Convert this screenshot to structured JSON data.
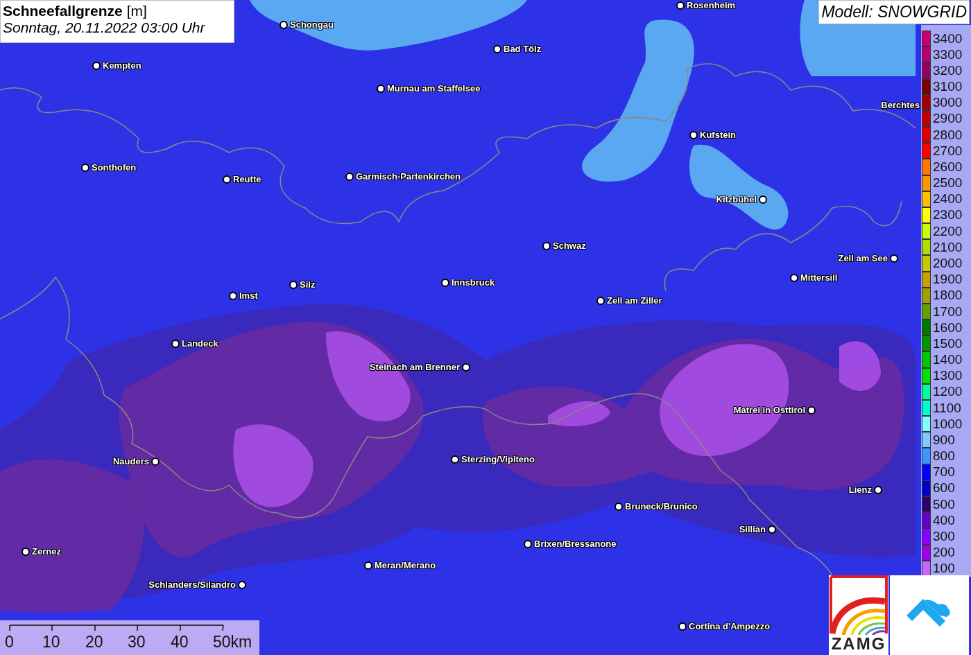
{
  "title": {
    "name": "Schneefallgrenze",
    "unit": "[m]",
    "date": "Sonntag, 20.11.2022 03:00 Uhr"
  },
  "model": "Modell: SNOWGRID",
  "cities": [
    {
      "name": "Rosenheim"
    },
    {
      "name": "Schongau"
    },
    {
      "name": "Kempten"
    },
    {
      "name": "Bad Tölz"
    },
    {
      "name": "Murnau am Staffelsee"
    },
    {
      "name": "Berchtes"
    },
    {
      "name": "Kufstein"
    },
    {
      "name": "Sonthofen"
    },
    {
      "name": "Reutte"
    },
    {
      "name": "Garmisch-Partenkirchen"
    },
    {
      "name": "Kitzbühel"
    },
    {
      "name": "Schwaz"
    },
    {
      "name": "Zell am See"
    },
    {
      "name": "Mittersill"
    },
    {
      "name": "Silz"
    },
    {
      "name": "Innsbruck"
    },
    {
      "name": "Imst"
    },
    {
      "name": "Zell am Ziller"
    },
    {
      "name": "Landeck"
    },
    {
      "name": "Steinach am Brenner"
    },
    {
      "name": "Matrei in Osttirol"
    },
    {
      "name": "Nauders"
    },
    {
      "name": "Sterzing/Vipiteno"
    },
    {
      "name": "Lienz"
    },
    {
      "name": "Bruneck/Brunico"
    },
    {
      "name": "Sillian"
    },
    {
      "name": "Zernez"
    },
    {
      "name": "Brixen/Bressanone"
    },
    {
      "name": "Meran/Merano"
    },
    {
      "name": "Schlanders/Silandro"
    },
    {
      "name": "Cortina d'Ampezzo"
    }
  ],
  "legend": [
    {
      "label": "3400",
      "color": "#c8006e"
    },
    {
      "label": "3300",
      "color": "#b40070"
    },
    {
      "label": "3200",
      "color": "#96005f"
    },
    {
      "label": "3100",
      "color": "#780000"
    },
    {
      "label": "3000",
      "color": "#a00000"
    },
    {
      "label": "2900",
      "color": "#c00000"
    },
    {
      "label": "2800",
      "color": "#e00000"
    },
    {
      "label": "2700",
      "color": "#ff0000"
    },
    {
      "label": "2600",
      "color": "#ff7800"
    },
    {
      "label": "2500",
      "color": "#ff9600"
    },
    {
      "label": "2400",
      "color": "#ffbe00"
    },
    {
      "label": "2300",
      "color": "#ffff00"
    },
    {
      "label": "2200",
      "color": "#c8ff00"
    },
    {
      "label": "2100",
      "color": "#b4dc00"
    },
    {
      "label": "2000",
      "color": "#c8c800"
    },
    {
      "label": "1900",
      "color": "#c8a000"
    },
    {
      "label": "1800",
      "color": "#a0a000"
    },
    {
      "label": "1700",
      "color": "#64a000"
    },
    {
      "label": "1600",
      "color": "#007800"
    },
    {
      "label": "1500",
      "color": "#009600"
    },
    {
      "label": "1400",
      "color": "#00c800"
    },
    {
      "label": "1300",
      "color": "#00e600"
    },
    {
      "label": "1200",
      "color": "#00ff96"
    },
    {
      "label": "1100",
      "color": "#00ffc8"
    },
    {
      "label": "1000",
      "color": "#80ffff"
    },
    {
      "label": "900",
      "color": "#80c8ff"
    },
    {
      "label": "800",
      "color": "#3c96ff"
    },
    {
      "label": "700",
      "color": "#0000ff"
    },
    {
      "label": "600",
      "color": "#0000c8"
    },
    {
      "label": "500",
      "color": "#32006e"
    },
    {
      "label": "400",
      "color": "#6400c8"
    },
    {
      "label": "300",
      "color": "#8c00ff"
    },
    {
      "label": "200",
      "color": "#a000e6"
    },
    {
      "label": "100",
      "color": "#c864ff"
    }
  ],
  "scale": [
    "0",
    "10",
    "20",
    "30",
    "40",
    "50km"
  ],
  "logo": {
    "text": "ZAMG"
  }
}
